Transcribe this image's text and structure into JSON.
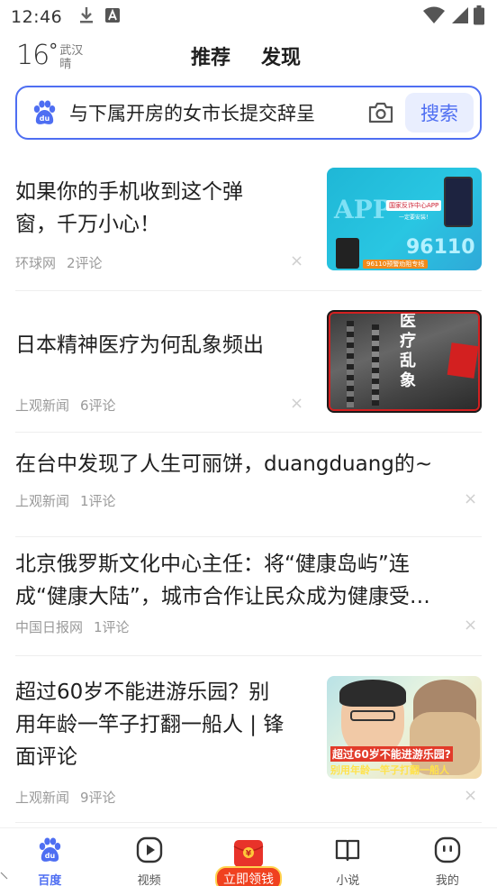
{
  "status_bar": {
    "time": "12:46",
    "icons": [
      "download-icon",
      "a-notification-icon",
      "wifi-icon",
      "signal-icon",
      "battery-icon"
    ]
  },
  "header": {
    "temperature": "16",
    "degree": "°",
    "city": "武汉",
    "weather": "晴",
    "tabs": [
      "推荐",
      "发现"
    ]
  },
  "search": {
    "query": "与下属开房的女市长提交辞呈",
    "button_label": "搜索",
    "accent_color": "#4e6ef2"
  },
  "feed": [
    {
      "title": "如果你的手机收到这个弹窗，千万小心！",
      "title_line1": "如果你的手机收到这个弹",
      "title_line2": "窗，千万小心！",
      "source": "环球网",
      "comments": "2评论",
      "thumb_texts": [
        "APP",
        "国家反诈中心APP",
        "一定要安装！",
        "96110",
        "96110预警劝阻专线"
      ]
    },
    {
      "title": "日本精神医疗为何乱象频出",
      "source": "上观新闻",
      "comments": "6评论",
      "thumb_texts": [
        "医",
        "疗",
        "乱",
        "象"
      ]
    },
    {
      "title": "在台中发现了人生可丽饼，duangduang的~",
      "source": "上观新闻",
      "comments": "1评论"
    },
    {
      "title_line1": "北京俄罗斯文化中心主任：将“健康岛屿”连",
      "title_line2": "成“健康大陆”，城市合作让民众成为健康受…",
      "source": "中国日报网",
      "comments": "1评论"
    },
    {
      "title_line1": "超过60岁不能进游乐园？别",
      "title_line2": "用年龄一竿子打翻一船人 | 锋",
      "title_line3": "面评论",
      "source": "上观新闻",
      "comments": "9评论",
      "thumb_texts": [
        "超过60岁不能进游乐园?",
        "别用年龄一竿子打翻一船人"
      ]
    }
  ],
  "dismiss_glyph": "×",
  "bottom_nav": {
    "items": [
      {
        "label": "百度",
        "icon": "baidu-paw-icon",
        "active": true
      },
      {
        "label": "视频",
        "icon": "video-play-icon",
        "active": false
      },
      {
        "label": "立即领钱",
        "icon": "red-envelope-icon",
        "active": false
      },
      {
        "label": "小说",
        "icon": "book-icon",
        "active": false
      },
      {
        "label": "我的",
        "icon": "profile-face-icon",
        "active": false
      }
    ],
    "envelope_glyph": "¥"
  }
}
